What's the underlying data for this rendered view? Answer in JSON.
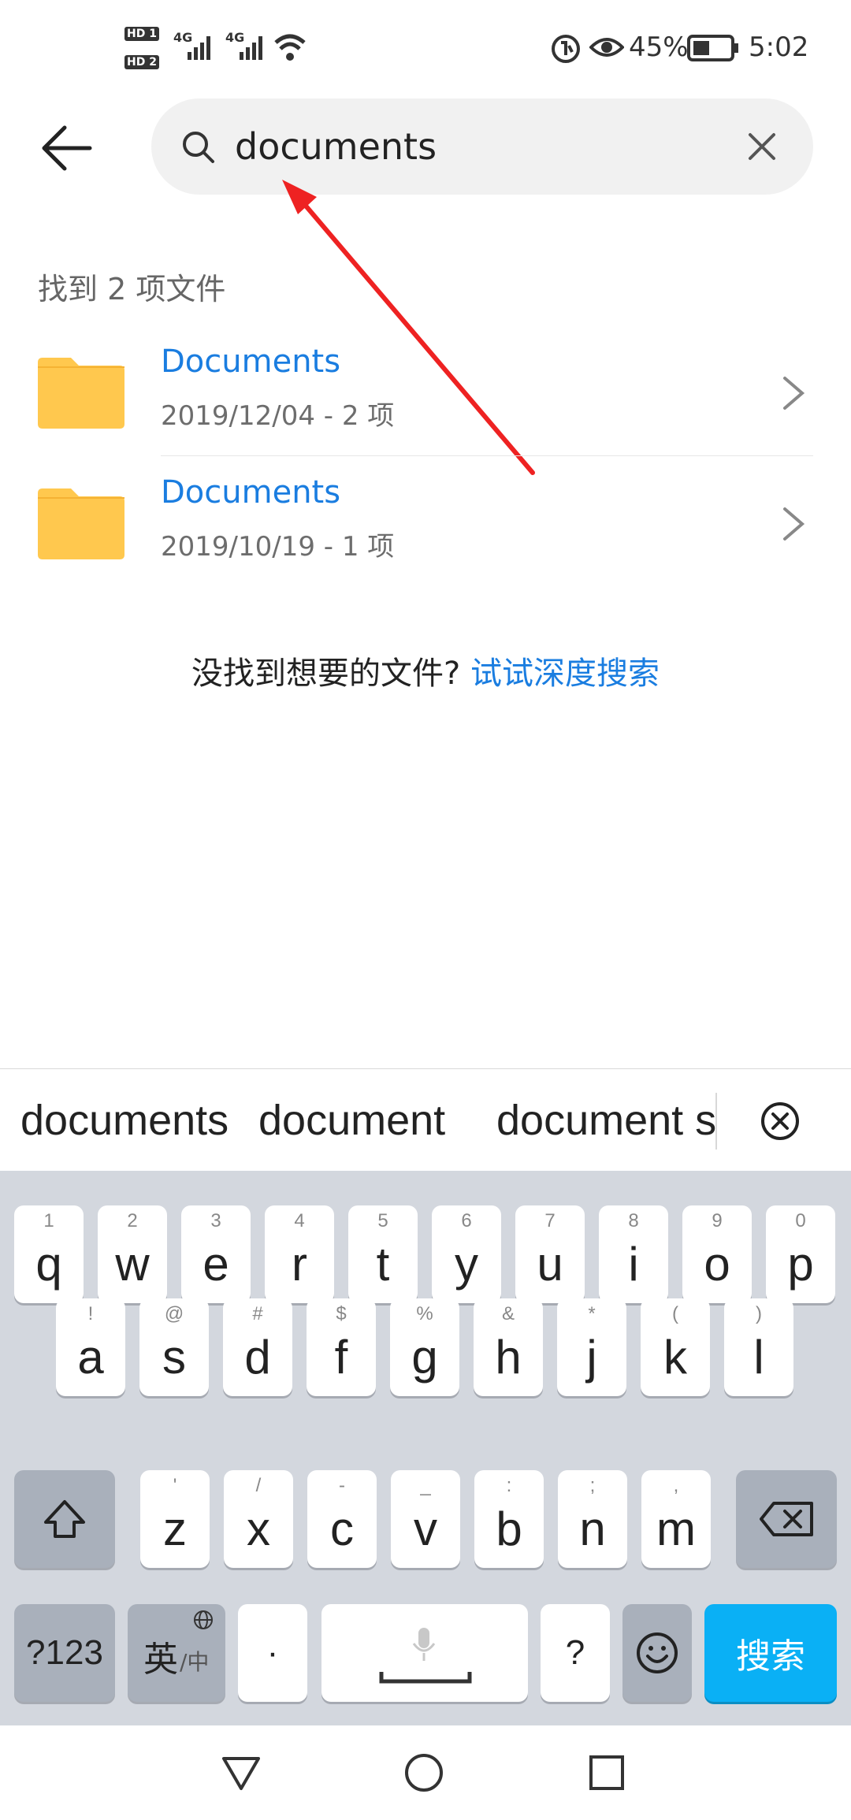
{
  "status_bar": {
    "hd1": "HD 1",
    "hd2": "HD 2",
    "net1": "4G",
    "net2": "4G",
    "battery_pct": "45%",
    "time": "5:02",
    "battery_level": 0.45
  },
  "search": {
    "query": "documents",
    "back_icon": "back-arrow-icon",
    "search_icon": "search-icon",
    "clear_icon": "close-icon"
  },
  "results": {
    "count_label": "找到 2 项文件",
    "items": [
      {
        "title": "Documents",
        "meta": "2019/12/04 - 2 项"
      },
      {
        "title": "Documents",
        "meta": "2019/10/19 - 1 项"
      }
    ]
  },
  "deep_search": {
    "prompt": "没找到想要的文件?",
    "link": "试试深度搜索"
  },
  "suggestions": [
    "documents",
    "document",
    "document s"
  ],
  "keyboard": {
    "row1": [
      {
        "main": "q",
        "sub": "1"
      },
      {
        "main": "w",
        "sub": "2"
      },
      {
        "main": "e",
        "sub": "3"
      },
      {
        "main": "r",
        "sub": "4"
      },
      {
        "main": "t",
        "sub": "5"
      },
      {
        "main": "y",
        "sub": "6"
      },
      {
        "main": "u",
        "sub": "7"
      },
      {
        "main": "i",
        "sub": "8"
      },
      {
        "main": "o",
        "sub": "9"
      },
      {
        "main": "p",
        "sub": "0"
      }
    ],
    "row2": [
      {
        "main": "a",
        "sub": "!"
      },
      {
        "main": "s",
        "sub": "@"
      },
      {
        "main": "d",
        "sub": "#"
      },
      {
        "main": "f",
        "sub": "$"
      },
      {
        "main": "g",
        "sub": "%"
      },
      {
        "main": "h",
        "sub": "&"
      },
      {
        "main": "j",
        "sub": "*"
      },
      {
        "main": "k",
        "sub": "("
      },
      {
        "main": "l",
        "sub": ")"
      }
    ],
    "row3": [
      {
        "main": "z",
        "sub": "'"
      },
      {
        "main": "x",
        "sub": "/"
      },
      {
        "main": "c",
        "sub": "-"
      },
      {
        "main": "v",
        "sub": "_"
      },
      {
        "main": "b",
        "sub": ":"
      },
      {
        "main": "n",
        "sub": ";"
      },
      {
        "main": "m",
        "sub": ","
      }
    ],
    "sym_key": "?123",
    "lang_key_main": "英",
    "lang_key_sub": "/中",
    "period_key": "·",
    "question_key": "?",
    "search_key": "搜索"
  }
}
